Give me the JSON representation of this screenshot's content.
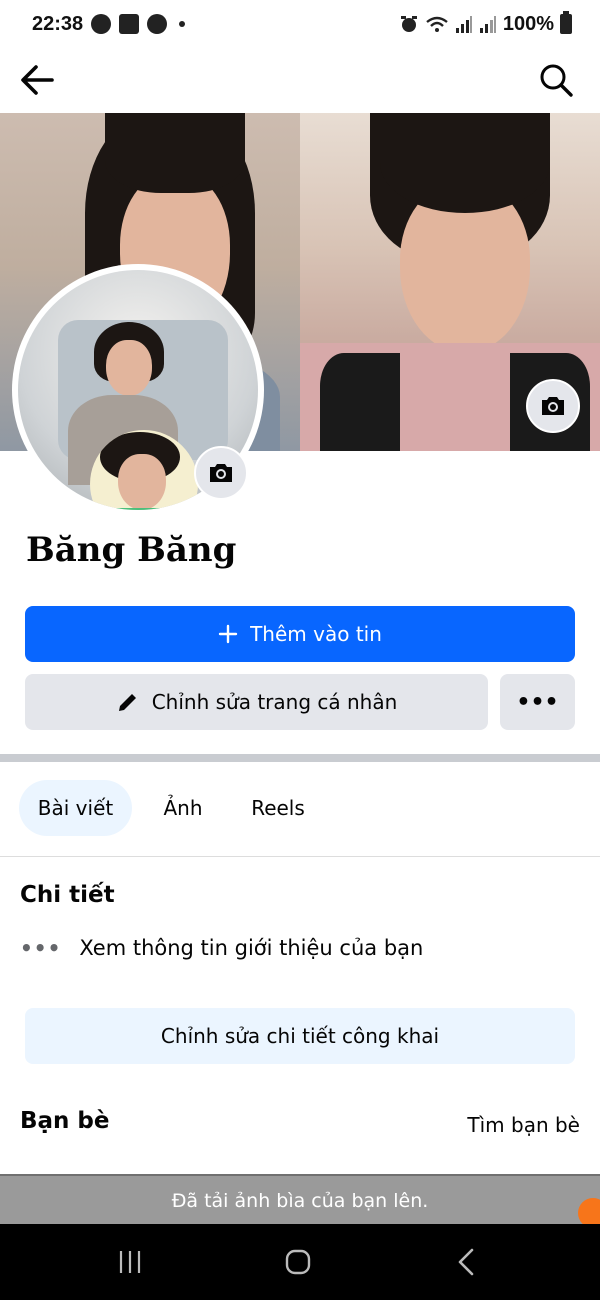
{
  "status_bar": {
    "time": "22:38",
    "battery": "100%",
    "left_icons": [
      "facebook-icon",
      "gallery-icon",
      "messenger-icon",
      "dot-icon"
    ],
    "right_icons": [
      "alarm-icon",
      "wifi-icon",
      "signal-icon",
      "signal-icon",
      "battery-icon"
    ]
  },
  "nav": {
    "back_icon": "arrow-left-icon",
    "search_icon": "search-icon"
  },
  "profile": {
    "name": "Băng Băng"
  },
  "actions": {
    "add_story": "Thêm vào tin",
    "edit_profile": "Chỉnh sửa trang cá nhân",
    "more": "•••"
  },
  "tabs": [
    {
      "label": "Bài viết",
      "active": true
    },
    {
      "label": "Ảnh",
      "active": false
    },
    {
      "label": "Reels",
      "active": false
    }
  ],
  "details": {
    "title": "Chi tiết",
    "intro": "Xem thông tin giới thiệu của bạn",
    "edit_public": "Chỉnh sửa chi tiết công khai"
  },
  "friends": {
    "title": "Bạn bè",
    "find": "Tìm bạn bè"
  },
  "toast": {
    "message": "Đã tải ảnh bìa của bạn lên."
  },
  "colors": {
    "primary": "#0866ff",
    "secondary_bg": "#e4e6eb",
    "light_blue": "#ebf5ff"
  }
}
